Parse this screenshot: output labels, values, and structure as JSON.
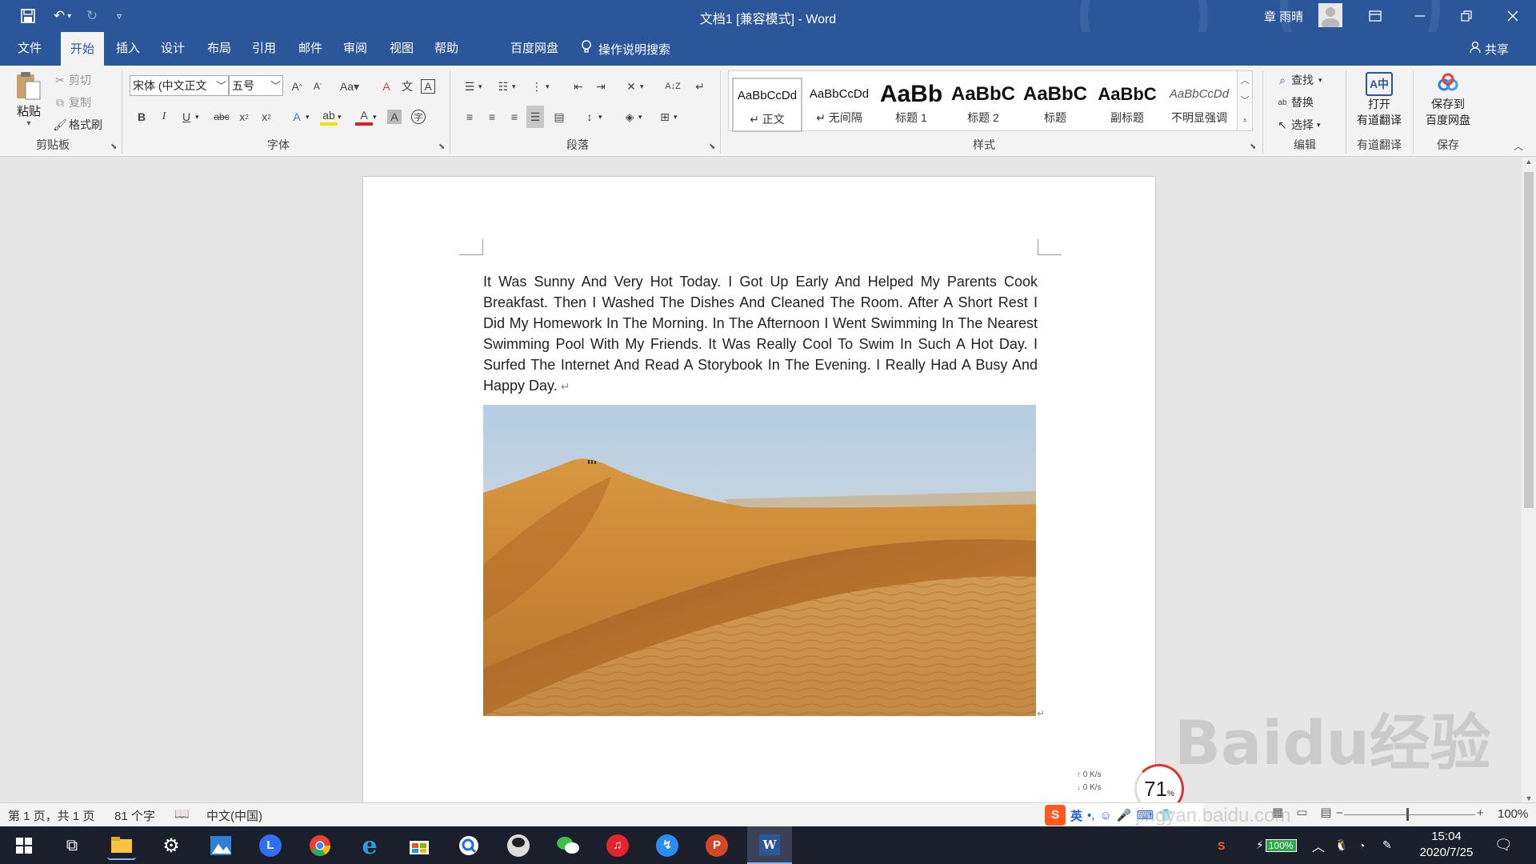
{
  "window": {
    "title": "文档1 [兼容模式] - Word",
    "user": "章 雨晴"
  },
  "tabs": [
    "文件",
    "开始",
    "插入",
    "设计",
    "布局",
    "引用",
    "邮件",
    "审阅",
    "视图",
    "帮助",
    "百度网盘"
  ],
  "search_label": "操作说明搜索",
  "share_label": "共享",
  "clipboard": {
    "paste": "粘贴",
    "cut": "剪切",
    "copy": "复制",
    "format_painter": "格式刷",
    "label": "剪贴板"
  },
  "font": {
    "name": "宋体 (中文正文",
    "size": "五号",
    "label": "字体"
  },
  "paragraph": {
    "label": "段落"
  },
  "styles": {
    "label": "样式",
    "items": [
      {
        "preview": "AaBbCcDd",
        "name": "↵ 正文"
      },
      {
        "preview": "AaBbCcDd",
        "name": "↵ 无间隔"
      },
      {
        "preview": "AaBb",
        "name": "标题 1"
      },
      {
        "preview": "AaBbC",
        "name": "标题 2"
      },
      {
        "preview": "AaBbC",
        "name": "标题"
      },
      {
        "preview": "AaBbC",
        "name": "副标题"
      },
      {
        "preview": "AaBbCcDd",
        "name": "不明显强调"
      }
    ]
  },
  "editing": {
    "find": "查找",
    "replace": "替换",
    "select": "选择",
    "label": "编辑"
  },
  "youdao": {
    "open": "打开",
    "translate": "有道翻译",
    "label": "有道翻译"
  },
  "baidu": {
    "save1": "保存到",
    "save2": "百度网盘",
    "label": "保存"
  },
  "document": {
    "paragraph": "It Was Sunny And Very Hot Today. I Got Up Early And Helped My Parents Cook Breakfast. Then I Washed The Dishes And Cleaned The Room. After A Short Rest I Did My Homework In The Morning. In The Afternoon I Went Swimming In The Nearest Swimming Pool With My Friends. It Was Really Cool To Swim In Such A Hot Day. I Surfed The Internet And Read A Storybook In The Evening. I Really Had A Busy And Happy Day.",
    "mark": "↵",
    "image_desc": "desert-dunes"
  },
  "status": {
    "page": "第 1 页，共 1 页",
    "words": "81 个字",
    "lang": "中文(中国)",
    "zoom": "100%"
  },
  "ime": {
    "lang": "英"
  },
  "netspeed": {
    "up": "0 K/s",
    "down": "0 K/s",
    "cpu": "71",
    "cpu_unit": "%"
  },
  "watermark": {
    "text": "Baidu经验",
    "url": "jingyan.baidu.com"
  },
  "taskbar": {
    "time": "15:04",
    "date": "2020/7/25",
    "battery": "100%"
  }
}
